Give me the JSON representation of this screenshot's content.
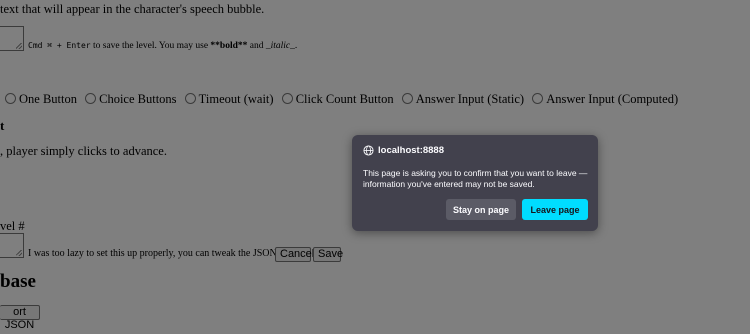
{
  "page": {
    "speech_desc": "text that will appear in the character's speech bubble.",
    "save_hint_keys": "Cmd ⌘ + Enter",
    "save_hint_mid": " to save the level. You may use ",
    "save_hint_bold": "**bold**",
    "save_hint_and": " and ",
    "save_hint_italic": "_italic_",
    "save_hint_end": ".",
    "response_options": [
      "One Button",
      "Choice Buttons",
      "Timeout (wait)",
      "Click Count Button",
      "Answer Input (Static)",
      "Answer Input (Computed)"
    ],
    "section_label": "t",
    "advance_desc": ", player simply clicks to advance.",
    "level_label": "vel #",
    "json_note": "I was too lazy to set this up properly, you can tweak the JSON itself :P",
    "cancel_label": "Cancel",
    "save_label": "Save",
    "heading": "base",
    "export_label": "ort JSON",
    "bottom_text": "... ...... ..... ...... .. ....... ..... .. .. ...... ......."
  },
  "dialog": {
    "host": "localhost:8888",
    "message": "This page is asking you to confirm that you want to leave — information you've entered may not be saved.",
    "stay_label": "Stay on page",
    "leave_label": "Leave page",
    "icon": "globe-icon"
  },
  "colors": {
    "overlay": "rgba(0,0,0,0.5)",
    "dialog_bg": "#42414d",
    "leave_accent": "#00ddff",
    "stay_bg": "#5b5b66"
  }
}
